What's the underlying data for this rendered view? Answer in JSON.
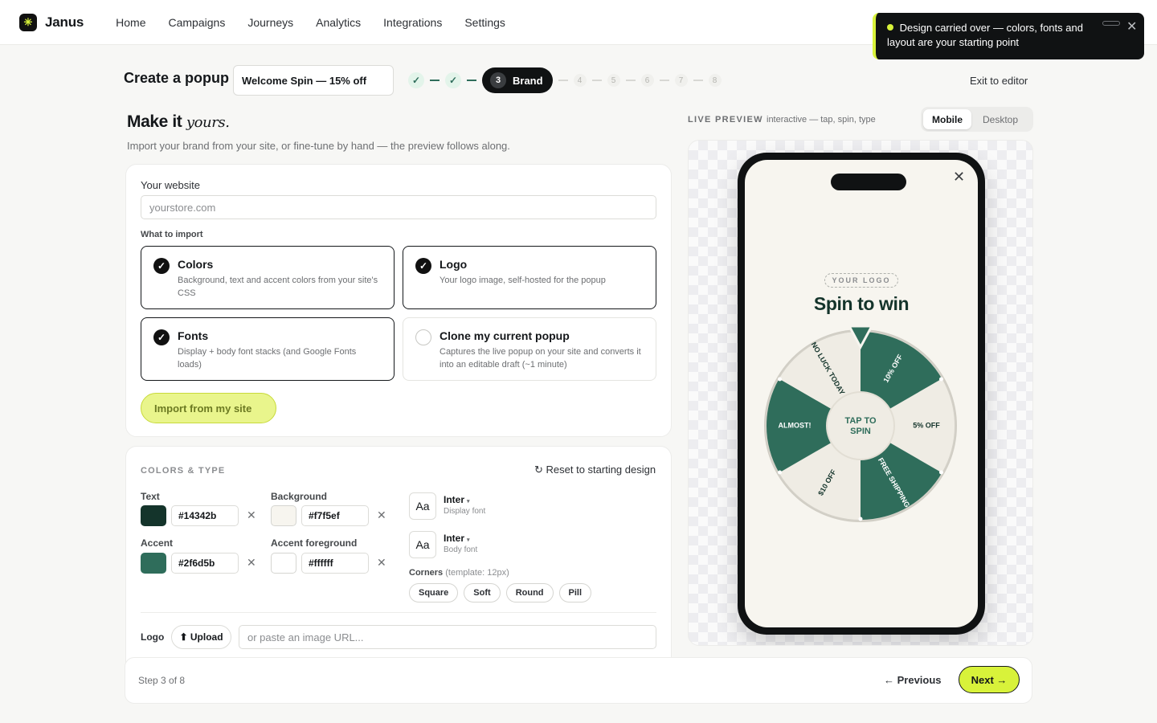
{
  "app": {
    "name": "Janus",
    "logo_icon": "asterisk-icon",
    "brand_color": "#d8f23a"
  },
  "nav": [
    {
      "label": "Home"
    },
    {
      "label": "Campaigns"
    },
    {
      "label": "Journeys"
    },
    {
      "label": "Analytics"
    },
    {
      "label": "Integrations"
    },
    {
      "label": "Settings"
    }
  ],
  "toast": {
    "message": "Design carried over — colors, fonts and layout are your starting point"
  },
  "header": {
    "title": "Create a popup",
    "popup_name": "Welcome Spin — 15% off",
    "exit_label": "Exit to editor"
  },
  "stepper": {
    "done_check": "✓",
    "active": {
      "number": "3",
      "label": "Brand"
    },
    "future": [
      "4",
      "5",
      "6",
      "7",
      "8"
    ]
  },
  "section": {
    "title_main": "Make it ",
    "title_italic": "yours.",
    "subtitle": "Import your brand from your site, or fine-tune by hand — the preview follows along."
  },
  "import": {
    "website_label": "Your website",
    "website_placeholder": "yourstore.com",
    "website_value": "",
    "what_label": "What to import",
    "check_glyph": "✓",
    "options": [
      {
        "title": "Colors",
        "desc": "Background, text and accent colors from your site's CSS",
        "checked": true
      },
      {
        "title": "Logo",
        "desc": "Your logo image, self-hosted for the popup",
        "checked": true
      },
      {
        "title": "Fonts",
        "desc": "Display + body font stacks (and Google Fonts loads)",
        "checked": true
      },
      {
        "title": "Clone my current popup",
        "desc": "Captures the live popup on your site and converts it into an editable draft (~1 minute)",
        "checked": false
      }
    ],
    "button_label": "Import from my site"
  },
  "colors_type": {
    "eyebrow": "COLORS & TYPE",
    "reset_label": "↻ Reset to starting design",
    "clear_glyph": "✕",
    "colors": [
      {
        "label": "Text",
        "value": "#14342b"
      },
      {
        "label": "Background",
        "value": "#f7f5ef"
      },
      {
        "label": "Accent",
        "value": "#2f6d5b"
      },
      {
        "label": "Accent foreground",
        "value": "#ffffff"
      }
    ],
    "fonts": [
      {
        "sample": "Aa",
        "name": "Inter",
        "role": "Display font"
      },
      {
        "sample": "Aa",
        "name": "Inter",
        "role": "Body font"
      }
    ],
    "font_caret": "▾",
    "corners_label": "Corners",
    "corners_hint": "(template: 12px)",
    "corners": [
      "Square",
      "Soft",
      "Round",
      "Pill"
    ],
    "logo_label": "Logo",
    "upload_label": "⬆ Upload",
    "logo_url_placeholder": "or paste an image URL..."
  },
  "preview": {
    "title": "LIVE PREVIEW",
    "subtitle": "interactive — tap, spin, type",
    "modes": [
      "Mobile",
      "Desktop"
    ],
    "active_mode": "Mobile",
    "close_glyph": "✕",
    "logo_placeholder": "YOUR LOGO",
    "headline": "Spin to win",
    "wheel_center": [
      "TAP TO",
      "SPIN"
    ],
    "wheel_segments": [
      "10% OFF",
      "5% OFF",
      "FREE SHIPPING",
      "$10 OFF",
      "ALMOST!",
      "NO LUCK TODAY"
    ]
  },
  "footer": {
    "step_info": "Step 3 of 8",
    "prev_label": "← Previous",
    "next_label": "Next →"
  }
}
